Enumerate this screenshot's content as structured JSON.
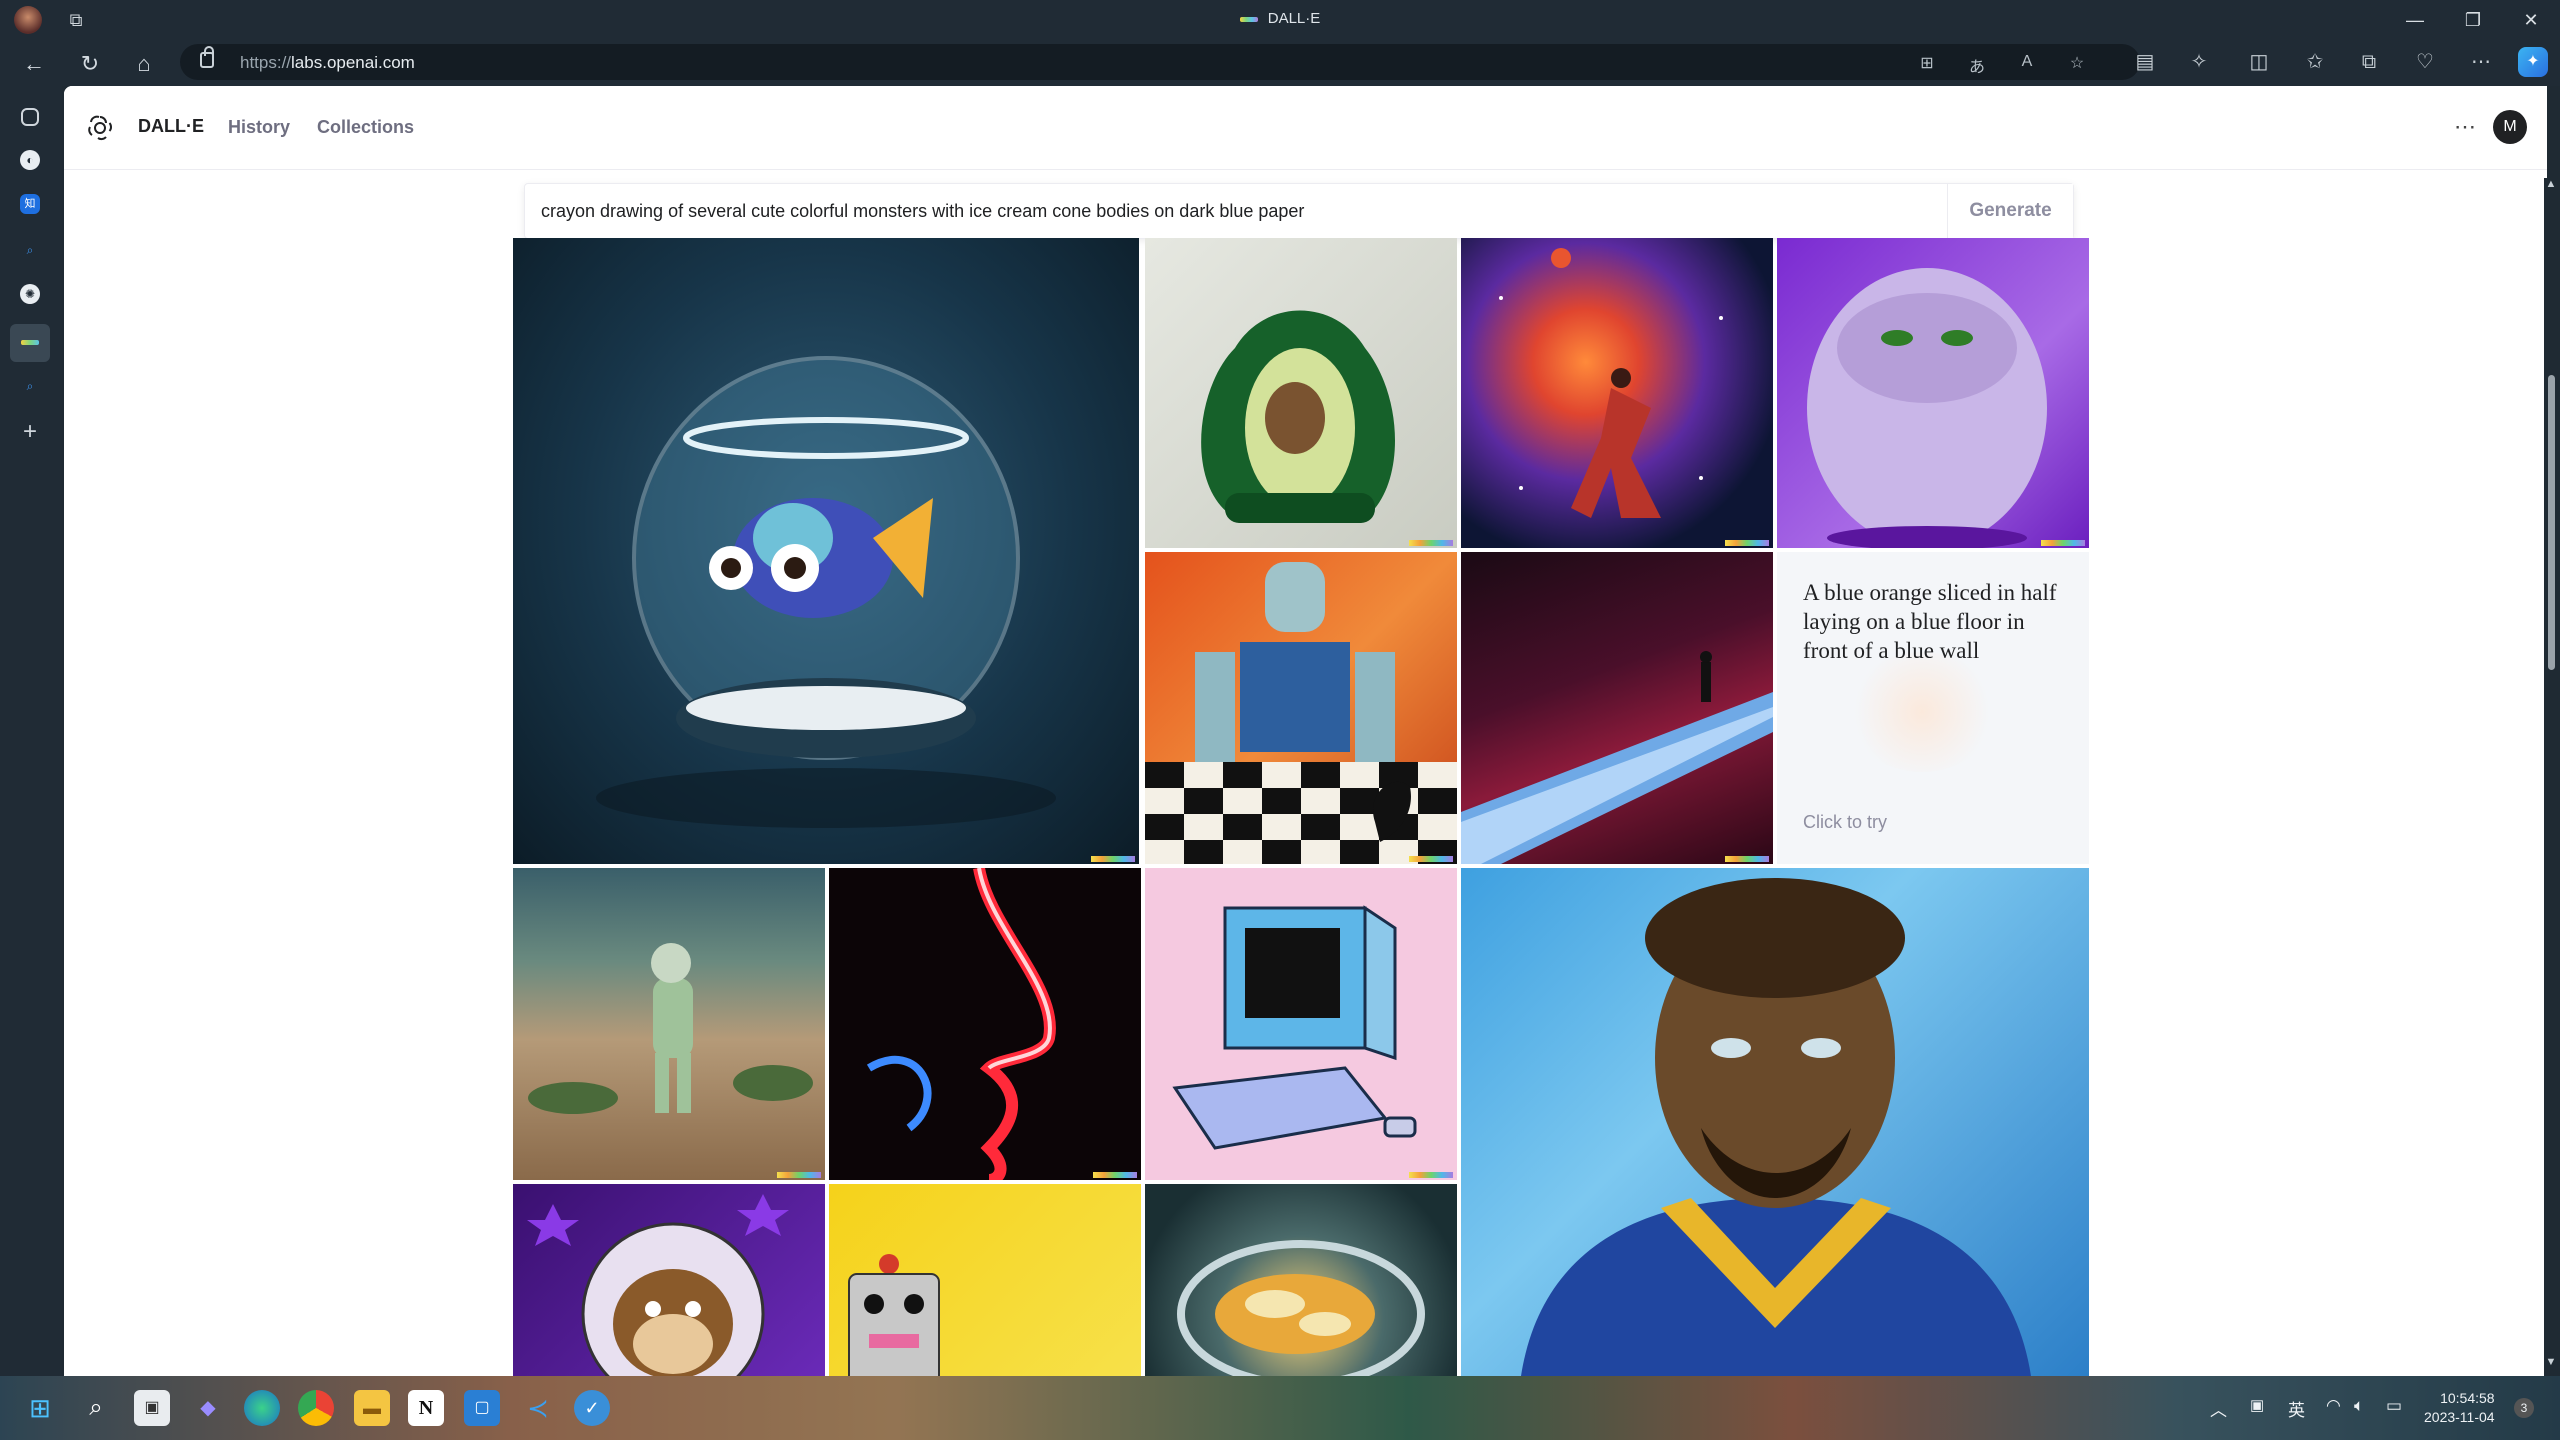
{
  "browser": {
    "tab_title": "DALL·E",
    "url_protocol": "https://",
    "url_host": "labs.openai.com"
  },
  "app": {
    "brand": "DALL·E",
    "nav": [
      "History",
      "Collections"
    ],
    "avatar_initial": "M"
  },
  "prompt": {
    "value": "crayon drawing of several cute colorful monsters with ice cream cone bodies on dark blue paper",
    "generate_label": "Generate"
  },
  "gallery": {
    "tryout_text": "A blue orange sliced in half laying on a blue floor in front of a blue wall",
    "tryout_cta": "Click to try"
  },
  "taskbar": {
    "time": "10:54:58",
    "date": "2023-11-04",
    "ime": "英",
    "notification_count": "3"
  },
  "colors": {
    "page_bg": "#ffffff",
    "chrome_bg": "#202b35",
    "text_primary": "#202123",
    "text_muted": "#6e6e80"
  }
}
